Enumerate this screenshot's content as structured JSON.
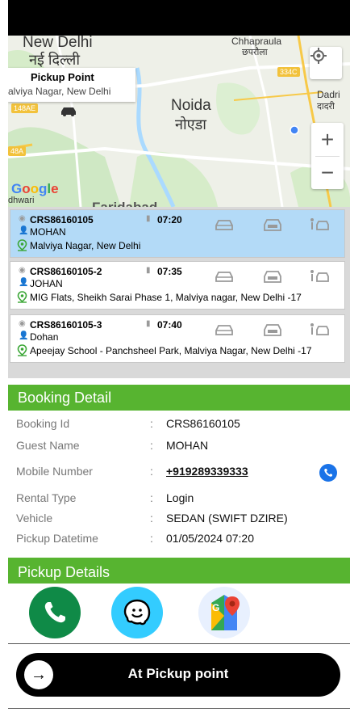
{
  "map": {
    "labels": {
      "new_delhi_en": "New Delhi",
      "new_delhi_hi": "नई दिल्ली",
      "chhapraula_en": "Chhapraula",
      "chhapraula_hi": "छपरौला",
      "noida_en": "Noida",
      "noida_hi": "नोएडा",
      "dadri_en": "Dadri",
      "dadri_hi": "दादरी",
      "road_334c": "334C",
      "road_148ae": "148AE",
      "road_48a": "48A",
      "faridabad_partial": "Faridabad",
      "dhwari_partial": "dhwari"
    },
    "pickup_bubble": {
      "title": "Pickup Point",
      "subtitle": "alviya Nagar, New Delhi"
    },
    "google": "Google",
    "zoom_in": "+",
    "zoom_out": "−"
  },
  "bookings": [
    {
      "id": "CRS86160105",
      "time": "07:20",
      "guest": "MOHAN",
      "address": "Malviya Nagar, New Delhi",
      "selected": true
    },
    {
      "id": "CRS86160105-2",
      "time": "07:35",
      "guest": "JOHAN",
      "address": "MIG Flats, Sheikh Sarai Phase 1, Malviya nagar, New Delhi -17",
      "selected": false
    },
    {
      "id": "CRS86160105-3",
      "time": "07:40",
      "guest": "Dohan",
      "address": "Apeejay School - Panchsheel Park, Malviya Nagar, New Delhi -17",
      "selected": false
    }
  ],
  "booking_detail": {
    "title": "Booking Detail",
    "separator": ":",
    "rows": {
      "booking_id": {
        "label": "Booking Id",
        "value": "CRS86160105"
      },
      "guest_name": {
        "label": "Guest Name",
        "value": "MOHAN"
      },
      "mobile": {
        "label": "Mobile Number",
        "value": "+919289339333"
      },
      "rental_type": {
        "label": "Rental Type",
        "value": "Login"
      },
      "vehicle": {
        "label": "Vehicle",
        "value": "SEDAN (SWIFT DZIRE)"
      },
      "pickup_datetime": {
        "label": "Pickup Datetime",
        "value": "01/05/2024 07:20"
      }
    }
  },
  "pickup_details": {
    "title": "Pickup Details"
  },
  "cta": {
    "label": "At Pickup point",
    "arrow": "→"
  },
  "colors": {
    "green": "#57b430",
    "selected_card": "#b3daf7",
    "phone_blue": "#1a73e8",
    "call_green": "#0f8a47",
    "waze_blue": "#33ccff"
  }
}
